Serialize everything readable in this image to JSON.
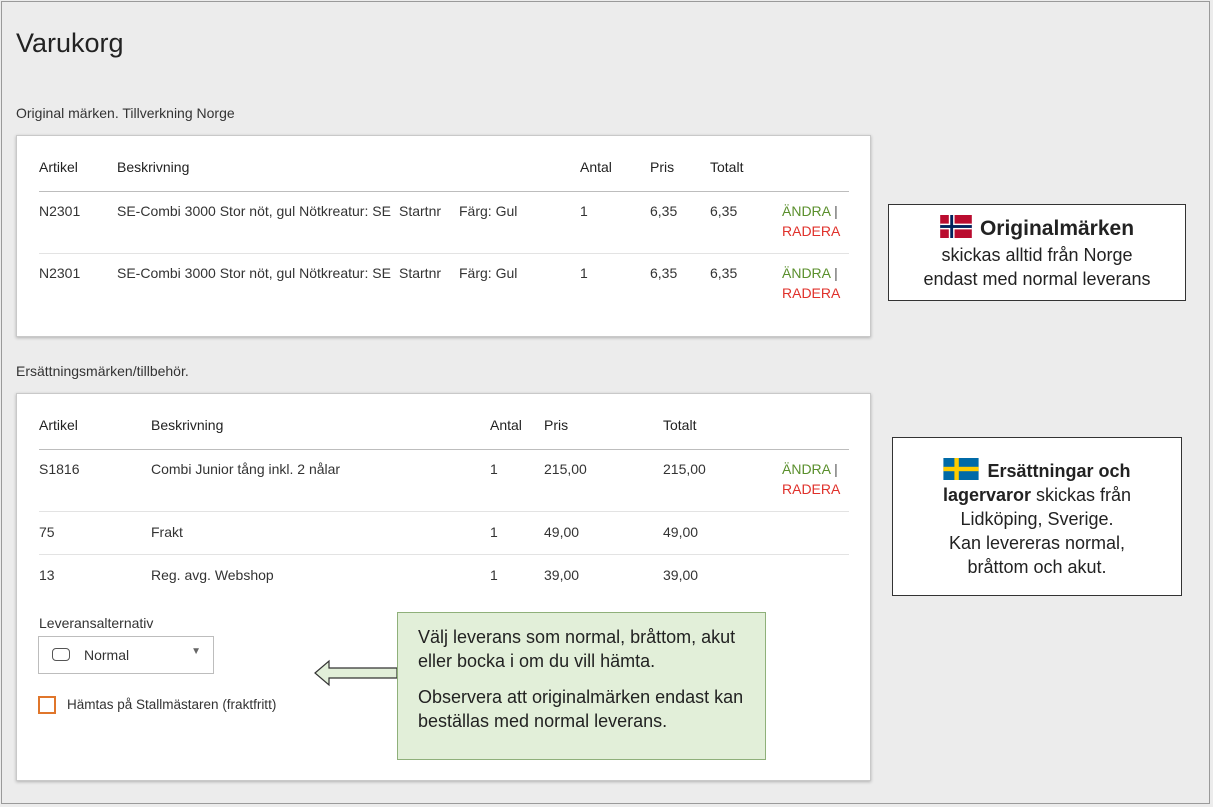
{
  "page": {
    "title": "Varukorg"
  },
  "sections": {
    "original": {
      "title": "Original märken. Tillverkning Norge",
      "headers": {
        "article": "Artikel",
        "description": "Beskrivning",
        "qty": "Antal",
        "price": "Pris",
        "total": "Totalt"
      },
      "rows": [
        {
          "article": "N2301",
          "description": "SE-Combi 3000 Stor nöt, gul Nötkreatur: SE",
          "option1": "Startnr",
          "option2": "Färg: Gul",
          "qty": "1",
          "price": "6,35",
          "total": "6,35",
          "edit": "ÄNDRA",
          "separator": "|",
          "delete": "RADERA"
        },
        {
          "article": "N2301",
          "description": "SE-Combi 3000 Stor nöt, gul Nötkreatur: SE",
          "option1": "Startnr",
          "option2": "Färg: Gul",
          "qty": "1",
          "price": "6,35",
          "total": "6,35",
          "edit": "ÄNDRA",
          "separator": "|",
          "delete": "RADERA"
        }
      ]
    },
    "replacement": {
      "title": "Ersättningsmärken/tillbehör.",
      "headers": {
        "article": "Artikel",
        "description": "Beskrivning",
        "qty": "Antal",
        "price": "Pris",
        "total": "Totalt"
      },
      "rows": [
        {
          "article": "S1816",
          "description": "Combi Junior tång inkl. 2 nålar",
          "qty": "1",
          "price": "215,00",
          "total": "215,00",
          "edit": "ÄNDRA",
          "separator": "|",
          "delete": "RADERA"
        },
        {
          "article": "75",
          "description": "Frakt",
          "qty": "1",
          "price": "49,00",
          "total": "49,00"
        },
        {
          "article": "13",
          "description": "Reg. avg. Webshop",
          "qty": "1",
          "price": "39,00",
          "total": "39,00"
        }
      ],
      "delivery": {
        "label": "Leveransalternativ",
        "selected": "Normal",
        "pickup_label": "Hämtas på Stallmästaren (fraktfritt)"
      }
    }
  },
  "notes": {
    "norway": {
      "bold": "Originalmärken",
      "line1": "skickas alltid från Norge",
      "line2": "endast med normal leverans"
    },
    "sweden": {
      "bold1": "Ersättningar och",
      "bold2": "lagervaror",
      "rest1": " skickas från",
      "line2": "Lidköping, Sverige.",
      "line3": "Kan levereras normal,",
      "line4": "bråttom och akut."
    }
  },
  "callout": {
    "p1": "Välj leverans som normal, bråttom, akut eller bocka i om du vill hämta.",
    "p2": "Observera att originalmärken endast kan beställas med normal leverans."
  },
  "colors": {
    "edit": "#5a8f2c",
    "delete": "#e0312b",
    "checkbox": "#e0762b",
    "callout_bg": "#e2efd9"
  },
  "icons": {
    "norway": "norway-flag-icon",
    "sweden": "sweden-flag-icon",
    "select": "chevron-down-icon",
    "arrow": "left-arrow-icon"
  }
}
